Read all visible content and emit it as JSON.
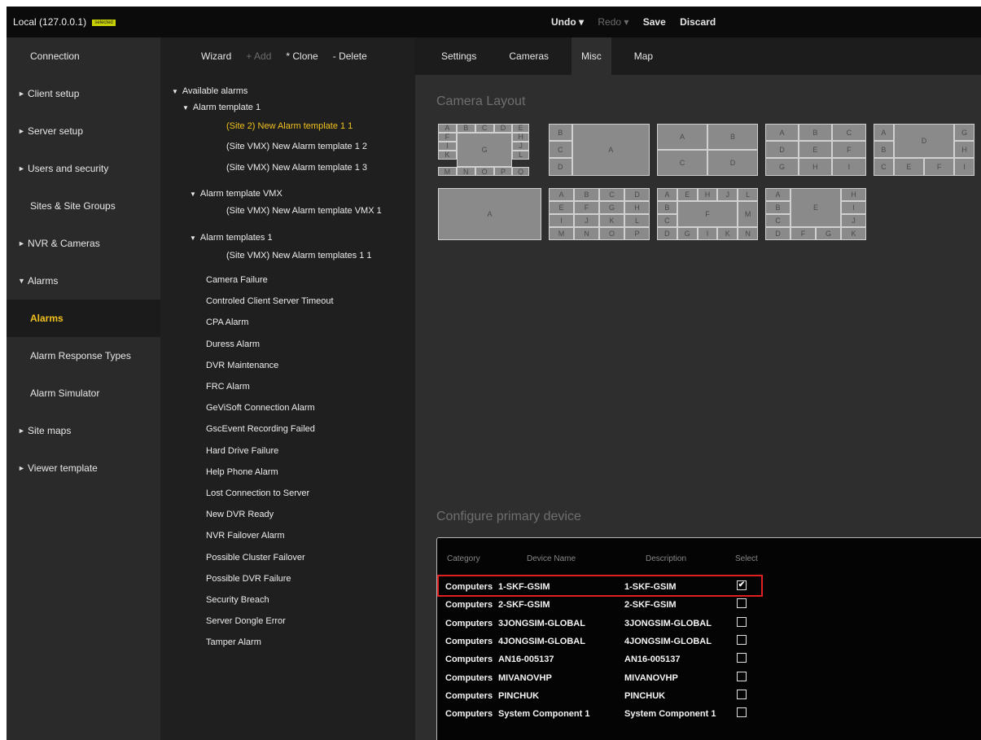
{
  "topbar": {
    "connection_title": "Local (127.0.0.1)",
    "connection_badge": "selected",
    "undo": "Undo ▾",
    "redo": "Redo ▾",
    "save": "Save",
    "discard": "Discard"
  },
  "sidebar": {
    "items": [
      {
        "label": "Connection",
        "caret": ""
      },
      {
        "label": "Client setup",
        "caret": "►"
      },
      {
        "label": "Server setup",
        "caret": "►"
      },
      {
        "label": "Users and security",
        "caret": "►"
      },
      {
        "label": "Sites & Site Groups",
        "caret": ""
      },
      {
        "label": "NVR & Cameras",
        "caret": "►"
      },
      {
        "label": "Alarms",
        "caret": "▼"
      },
      {
        "label": "Alarms",
        "caret": ""
      },
      {
        "label": "Alarm Response Types",
        "caret": ""
      },
      {
        "label": "Alarm Simulator",
        "caret": ""
      },
      {
        "label": "Site maps",
        "caret": "►"
      },
      {
        "label": "Viewer template",
        "caret": "►"
      }
    ]
  },
  "tree_toolbar": {
    "wizard": "Wizard",
    "add": "+ Add",
    "clone": "* Clone",
    "delete": "- Delete"
  },
  "tree": {
    "root": "Available alarms",
    "groups": [
      {
        "label": "Alarm template 1",
        "children": [
          "(Site 2) New Alarm template 1 1",
          "(Site VMX) New Alarm template 1 2",
          "(Site VMX) New Alarm template 1 3"
        ]
      },
      {
        "label": "Alarm template VMX",
        "children": [
          "(Site VMX) New Alarm template VMX 1"
        ]
      },
      {
        "label": "Alarm templates 1",
        "children": [
          "(Site VMX) New Alarm templates 1 1"
        ]
      }
    ],
    "alarms": [
      "Camera Failure",
      "Controled Client Server Timeout",
      "CPA Alarm",
      "Duress Alarm",
      "DVR Maintenance",
      "FRC Alarm",
      "GeViSoft Connection Alarm",
      "GscEvent Recording Failed",
      "Hard Drive Failure",
      "Help Phone Alarm",
      "Lost Connection to Server",
      "New DVR Ready",
      "NVR Failover Alarm",
      "Possible Cluster Failover",
      "Possible DVR Failure",
      "Security Breach",
      "Server Dongle Error",
      "Tamper Alarm"
    ]
  },
  "tabs": [
    "Settings",
    "Cameras",
    "Misc",
    "Map"
  ],
  "camera_layout": {
    "title": "Camera Layout",
    "layouts": [
      {
        "cells": [
          "A",
          "B",
          "C",
          "D",
          "E",
          "F",
          "H",
          "G",
          "I",
          "J",
          "K",
          "L",
          "M",
          "N",
          "O",
          "P",
          "Q"
        ]
      },
      {
        "cells": [
          "B",
          "C",
          "A",
          "D"
        ]
      },
      {
        "cells": [
          "A",
          "B",
          "C",
          "D"
        ]
      },
      {
        "cells": [
          "A",
          "B",
          "C",
          "D",
          "E",
          "F",
          "G",
          "H",
          "I"
        ]
      },
      {
        "cells": [
          "A",
          "D",
          "G",
          "B",
          "H",
          "C",
          "E",
          "F",
          "I"
        ]
      },
      {
        "cells": [
          "A"
        ]
      },
      {
        "cells": [
          "A",
          "B",
          "C",
          "D",
          "E",
          "F",
          "G",
          "H",
          "I",
          "J",
          "K",
          "L",
          "M",
          "N",
          "O",
          "P"
        ]
      },
      {
        "cells": [
          "A",
          "E",
          "H",
          "J",
          "L",
          "B",
          "F",
          "M",
          "C",
          "D",
          "G",
          "I",
          "K",
          "N"
        ]
      },
      {
        "cells": [
          "A",
          "H",
          "B",
          "E",
          "I",
          "C",
          "J",
          "D",
          "F",
          "G",
          "K"
        ]
      }
    ]
  },
  "device_panel": {
    "title": "Configure primary device",
    "headers": {
      "category": "Category",
      "device_name": "Device Name",
      "description": "Description",
      "select": "Select"
    },
    "rows": [
      {
        "category": "Computers",
        "device_name": "1-SKF-GSIM",
        "description": "1-SKF-GSIM",
        "checked": "✔"
      },
      {
        "category": "Computers",
        "device_name": "2-SKF-GSIM",
        "description": "2-SKF-GSIM",
        "checked": ""
      },
      {
        "category": "Computers",
        "device_name": "3JONGSIM-GLOBAL",
        "description": "3JONGSIM-GLOBAL",
        "checked": ""
      },
      {
        "category": "Computers",
        "device_name": "4JONGSIM-GLOBAL",
        "description": "4JONGSIM-GLOBAL",
        "checked": ""
      },
      {
        "category": "Computers",
        "device_name": "AN16-005137",
        "description": "AN16-005137",
        "checked": ""
      },
      {
        "category": "Computers",
        "device_name": "MIVANOVHP",
        "description": "MIVANOVHP",
        "checked": ""
      },
      {
        "category": "Computers",
        "device_name": "PINCHUK",
        "description": "PINCHUK",
        "checked": ""
      },
      {
        "category": "Computers",
        "device_name": "System Component 1",
        "description": "System Component 1",
        "checked": ""
      }
    ]
  }
}
